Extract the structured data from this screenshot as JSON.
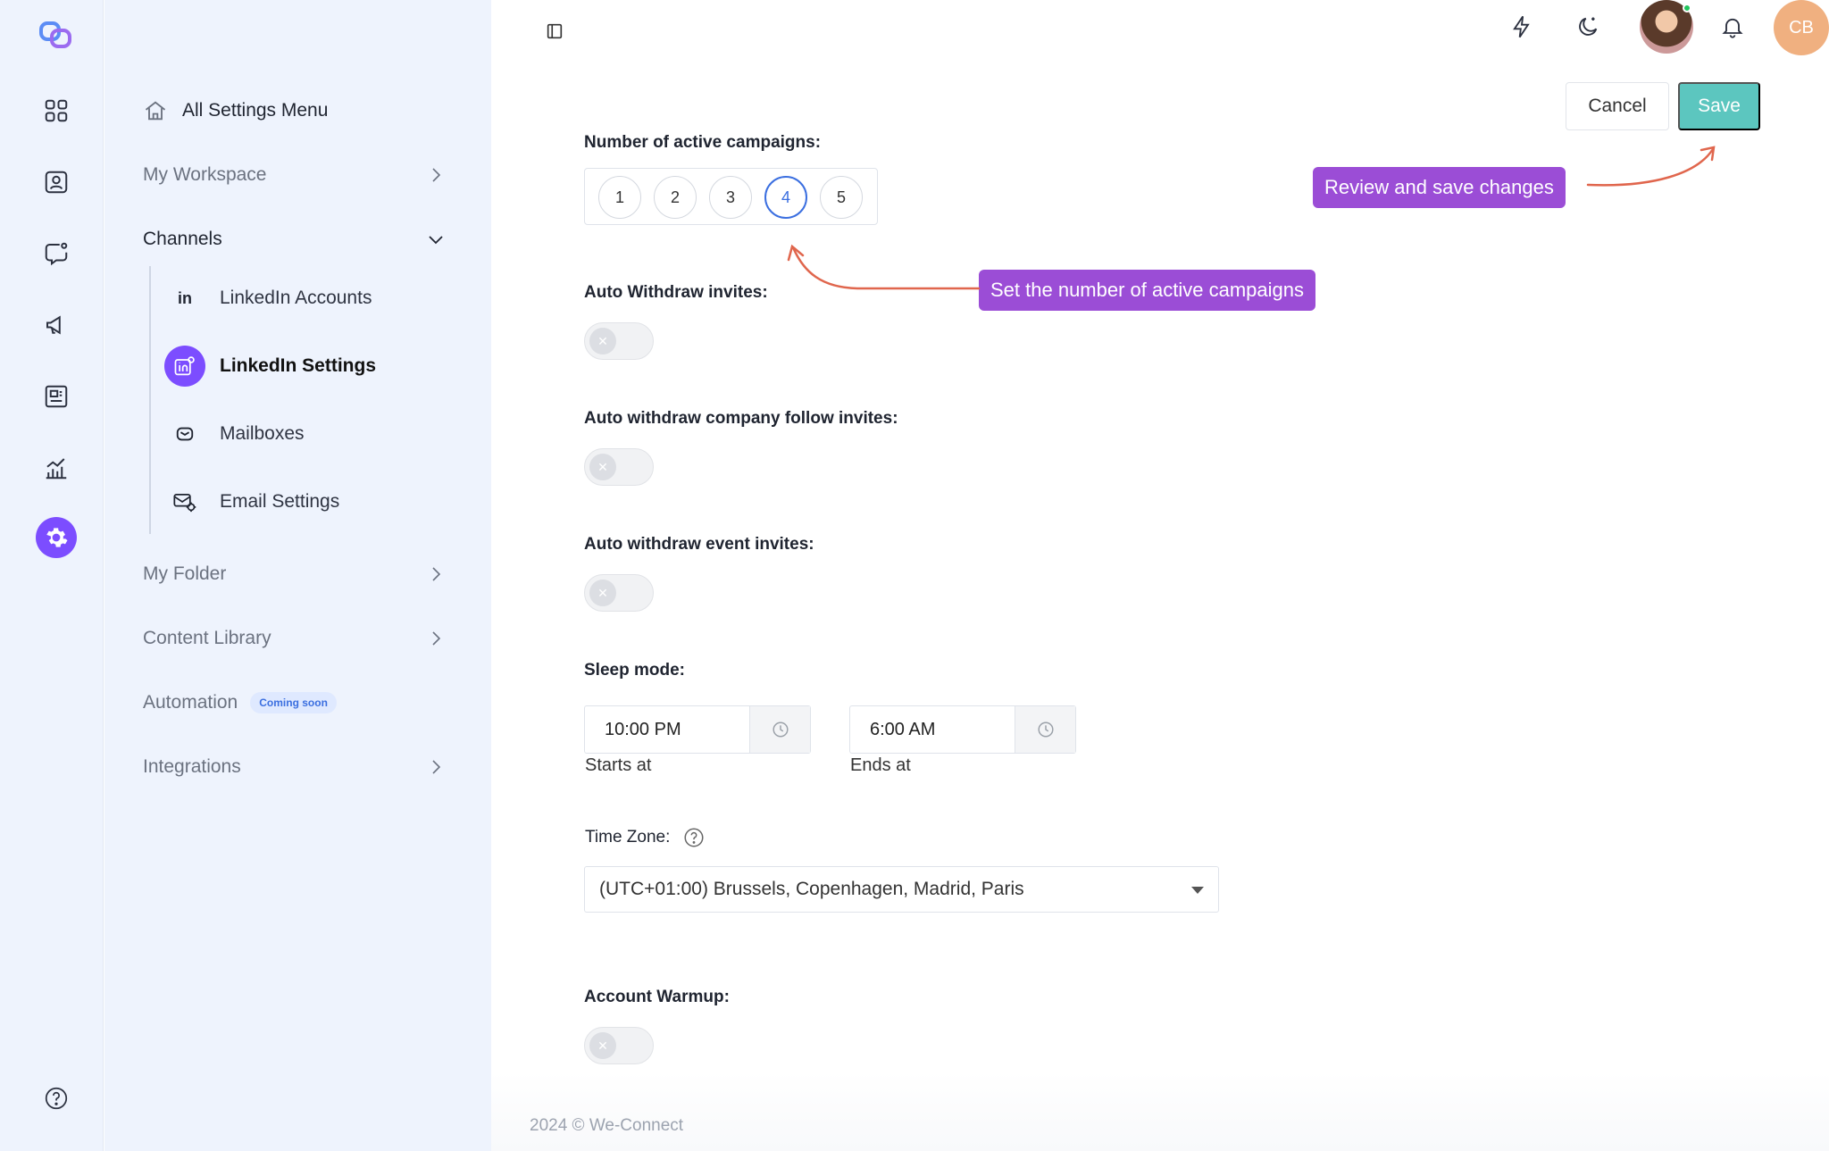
{
  "app": {
    "name": "We-Connect"
  },
  "sidebar": {
    "header": "All Settings Menu",
    "items": [
      {
        "label": "My Workspace"
      },
      {
        "label": "Channels"
      },
      {
        "label": "My Folder"
      },
      {
        "label": "Content Library"
      },
      {
        "label": "Automation",
        "badge": "Coming soon"
      },
      {
        "label": "Integrations"
      }
    ],
    "channels": [
      {
        "label": "LinkedIn Accounts",
        "icon": "linkedin-icon"
      },
      {
        "label": "LinkedIn Settings",
        "icon": "linkedin-settings-icon",
        "selected": true
      },
      {
        "label": "Mailboxes",
        "icon": "mailbox-icon"
      },
      {
        "label": "Email Settings",
        "icon": "email-settings-icon"
      }
    ]
  },
  "rail": {
    "icons": [
      "dashboard-icon",
      "contacts-icon",
      "messages-icon",
      "campaigns-icon",
      "templates-icon",
      "analytics-icon",
      "settings-icon",
      "help-icon"
    ],
    "active": "settings-icon"
  },
  "header": {
    "user_initials": "CB",
    "icons": [
      "lightning-icon",
      "dark-mode-icon",
      "user-avatar",
      "bell-icon"
    ]
  },
  "actions": {
    "cancel": "Cancel",
    "save": "Save"
  },
  "form": {
    "campaigns_label": "Number of active campaigns:",
    "campaign_options": [
      "1",
      "2",
      "3",
      "4",
      "5"
    ],
    "campaigns_selected": "4",
    "auto_withdraw_label": "Auto Withdraw invites:",
    "auto_withdraw_enabled": false,
    "auto_withdraw_company_label": "Auto withdraw company follow invites:",
    "auto_withdraw_company_enabled": false,
    "auto_withdraw_event_label": "Auto withdraw event invites:",
    "auto_withdraw_event_enabled": false,
    "sleep_label": "Sleep mode:",
    "sleep_start": "10:00 PM",
    "sleep_start_caption": "Starts at",
    "sleep_end": "6:00 AM",
    "sleep_end_caption": "Ends at",
    "timezone_label": "Time Zone:",
    "timezone_value": "(UTC+01:00) Brussels, Copenhagen, Madrid, Paris",
    "warmup_label": "Account Warmup:",
    "warmup_enabled": false
  },
  "callouts": {
    "save": "Review and save changes",
    "campaigns": "Set the number of active campaigns"
  },
  "footer": {
    "text": "2024 © We-Connect"
  },
  "colors": {
    "accent": "#7c4dff",
    "save": "#5cc6bf",
    "callout": "#9b4dd6",
    "arrow": "#e0664d",
    "selected": "#3b6fe0"
  }
}
